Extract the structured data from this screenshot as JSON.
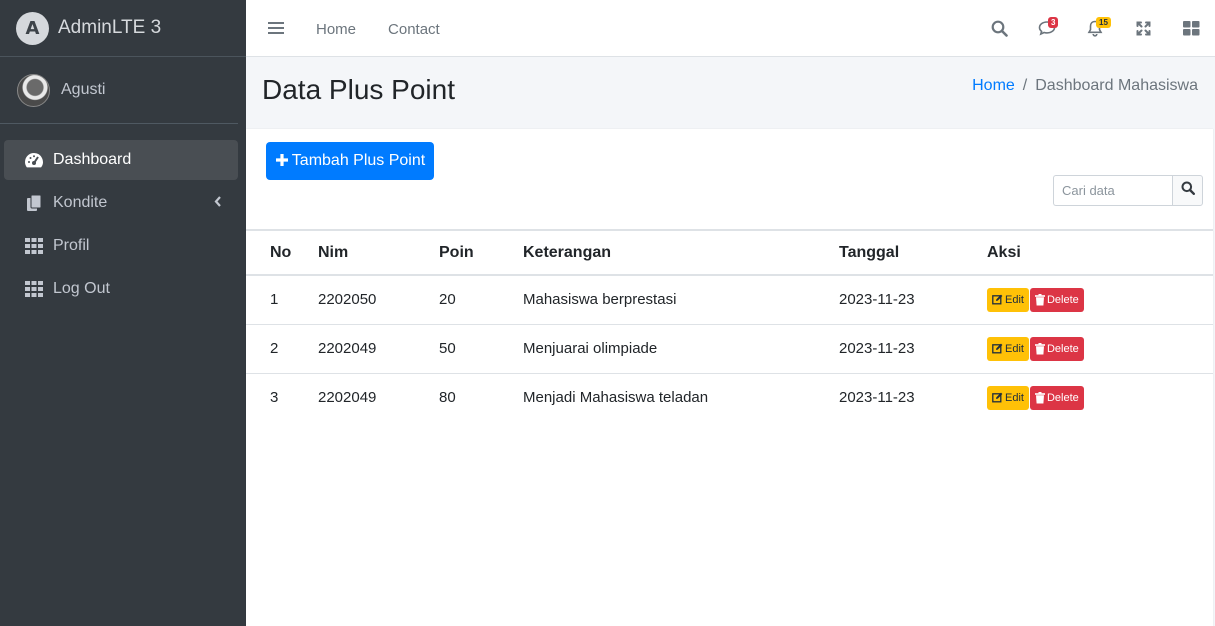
{
  "brand": {
    "logo_letter": "A",
    "name": "AdminLTE 3"
  },
  "user": {
    "name": "Agusti"
  },
  "sidebar": {
    "items": [
      {
        "label": "Dashboard",
        "icon": "tachometer-icon",
        "active": true
      },
      {
        "label": "Kondite",
        "icon": "copy-icon",
        "has_arrow": true
      },
      {
        "label": "Profil",
        "icon": "th-icon"
      },
      {
        "label": "Log Out",
        "icon": "th-icon"
      }
    ]
  },
  "topbar": {
    "links": [
      "Home",
      "Contact"
    ],
    "messages_count": "3",
    "notifications_count": "15"
  },
  "header": {
    "title": "Data Plus Point",
    "breadcrumb_home": "Home",
    "breadcrumb_separator": "/",
    "breadcrumb_current": "Dashboard Mahasiswa"
  },
  "card": {
    "add_button_label": "Tambah Plus Point",
    "search_placeholder": "Cari data"
  },
  "table": {
    "columns": [
      "No",
      "Nim",
      "Poin",
      "Keterangan",
      "Tanggal",
      "Aksi"
    ],
    "edit_label": "Edit",
    "delete_label": "Delete",
    "rows": [
      {
        "no": "1",
        "nim": "2202050",
        "poin": "20",
        "keterangan": "Mahasiswa berprestasi",
        "tanggal": "2023-11-23"
      },
      {
        "no": "2",
        "nim": "2202049",
        "poin": "50",
        "keterangan": "Menjuarai olimpiade",
        "tanggal": "2023-11-23"
      },
      {
        "no": "3",
        "nim": "2202049",
        "poin": "80",
        "keterangan": "Menjadi Mahasiswa teladan",
        "tanggal": "2023-11-23"
      }
    ]
  },
  "colors": {
    "sidebar": "#343a40",
    "primary": "#007bff",
    "warning": "#ffc107",
    "danger": "#dc3545"
  }
}
